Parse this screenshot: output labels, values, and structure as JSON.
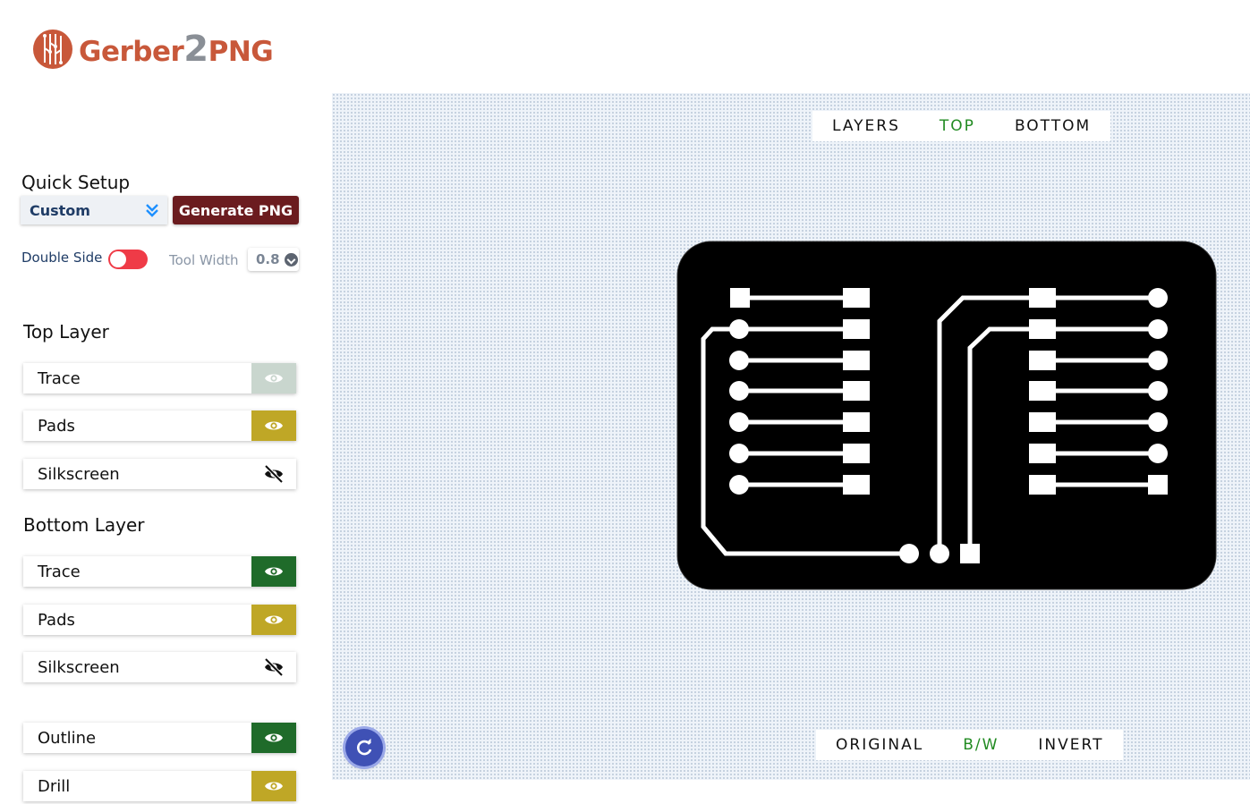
{
  "brand": {
    "part1": "Gerber",
    "part2": "2",
    "part3": "PNG"
  },
  "quick_setup": {
    "title": "Quick Setup",
    "select_value": "Custom",
    "generate_label": "Generate PNG"
  },
  "options": {
    "double_side_label": "Double Side",
    "double_side_on": false,
    "tool_width_label": "Tool Width",
    "tool_width_value": "0.8"
  },
  "top_layer": {
    "title": "Top Layer",
    "items": [
      {
        "label": "Trace",
        "visible": true,
        "color": "#c9d6ce",
        "icon": "eye-icon"
      },
      {
        "label": "Pads",
        "visible": true,
        "color": "#bfa726",
        "icon": "eye-icon"
      },
      {
        "label": "Silkscreen",
        "visible": false,
        "color": "#ffffff",
        "icon": "eye-off-icon"
      }
    ]
  },
  "bottom_layer": {
    "title": "Bottom Layer",
    "items": [
      {
        "label": "Trace",
        "visible": true,
        "color": "#1f6b2a",
        "icon": "eye-icon"
      },
      {
        "label": "Pads",
        "visible": true,
        "color": "#bfa726",
        "icon": "eye-icon"
      },
      {
        "label": "Silkscreen",
        "visible": false,
        "color": "#ffffff",
        "icon": "eye-off-icon"
      }
    ]
  },
  "other_layers": [
    {
      "label": "Outline",
      "visible": true,
      "color": "#1f6b2a",
      "icon": "eye-icon"
    },
    {
      "label": "Drill",
      "visible": true,
      "color": "#bfa726",
      "icon": "eye-icon"
    }
  ],
  "view_tabs": {
    "items": [
      "LAYERS",
      "TOP",
      "BOTTOM"
    ],
    "active": "TOP"
  },
  "mode_tabs": {
    "items": [
      "ORIGINAL",
      "B/W",
      "INVERT"
    ],
    "active": "B/W"
  },
  "colors": {
    "accent_green": "#228b22",
    "brand": "#c8583a",
    "generate_bg": "#6b1c1f",
    "toggle_off": "#ef3b47"
  }
}
